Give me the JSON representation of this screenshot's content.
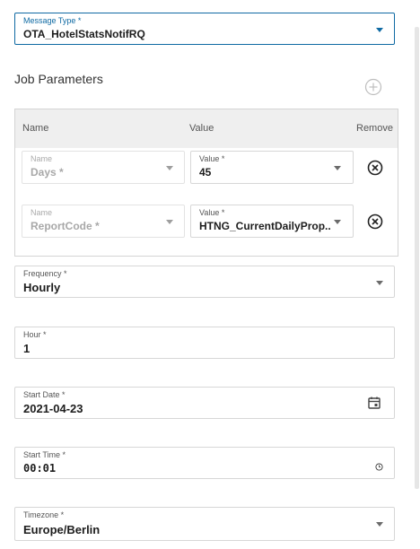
{
  "message_type": {
    "label": "Message Type *",
    "value": "OTA_HotelStatsNotifRQ"
  },
  "job_parameters": {
    "title": "Job Parameters",
    "columns": {
      "name": "Name",
      "value": "Value",
      "remove": "Remove"
    },
    "rows": [
      {
        "name_label": "Name",
        "name_value": "Days *",
        "value_label": "Value *",
        "value": "45"
      },
      {
        "name_label": "Name",
        "name_value": "ReportCode *",
        "value_label": "Value *",
        "value": "HTNG_CurrentDailyProp..."
      }
    ]
  },
  "frequency": {
    "label": "Frequency *",
    "value": "Hourly"
  },
  "hour": {
    "label": "Hour *",
    "value": "1"
  },
  "start_date": {
    "label": "Start Date *",
    "value": "2021-04-23"
  },
  "start_time": {
    "label": "Start Time *",
    "value": "00:01"
  },
  "timezone": {
    "label": "Timezone *",
    "value": "Europe/Berlin"
  },
  "icons": {
    "dropdown": "chevron-down-icon",
    "add": "add-circle-icon",
    "remove": "remove-circle-icon",
    "calendar": "calendar-icon",
    "clock": "clock-icon"
  },
  "colors": {
    "accent": "#0f6aa3",
    "border": "#d7d7d7",
    "header_bg": "#efefef"
  }
}
